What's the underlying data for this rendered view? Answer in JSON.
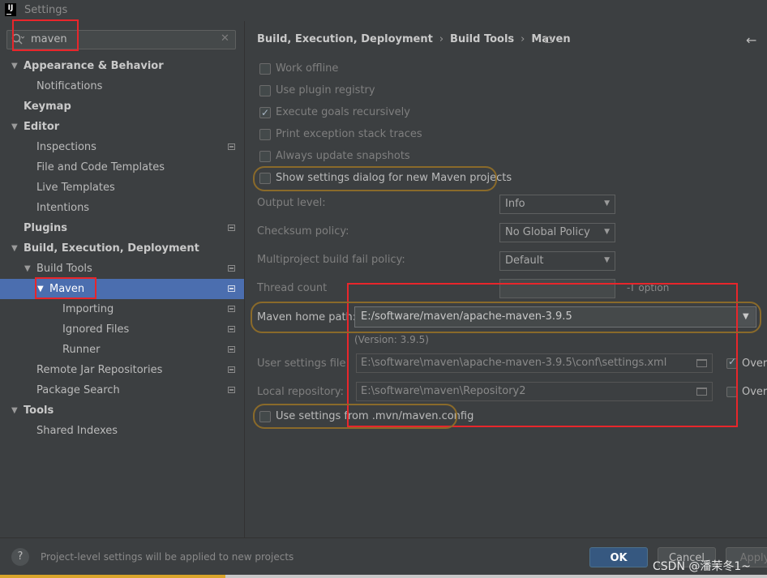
{
  "window": {
    "title": "Settings",
    "app_icon": "IJ"
  },
  "search": {
    "value": "maven"
  },
  "sidebar": {
    "items": [
      {
        "label": "Appearance & Behavior",
        "bold": true,
        "arrow": "▾"
      },
      {
        "label": "Notifications"
      },
      {
        "label": "Keymap",
        "bold": true
      },
      {
        "label": "Editor",
        "bold": true,
        "arrow": "▾"
      },
      {
        "label": "Inspections"
      },
      {
        "label": "File and Code Templates"
      },
      {
        "label": "Live Templates"
      },
      {
        "label": "Intentions"
      },
      {
        "label": "Plugins",
        "bold": true
      },
      {
        "label": "Build, Execution, Deployment",
        "bold": true,
        "arrow": "▾"
      },
      {
        "label": "Build Tools",
        "arrow": "▾"
      },
      {
        "label": "Maven",
        "arrow": "▾",
        "selected": true
      },
      {
        "label": "Importing"
      },
      {
        "label": "Ignored Files"
      },
      {
        "label": "Runner"
      },
      {
        "label": "Remote Jar Repositories"
      },
      {
        "label": "Package Search"
      },
      {
        "label": "Tools",
        "bold": true,
        "arrow": "▾"
      },
      {
        "label": "Shared Indexes"
      }
    ]
  },
  "breadcrumb": {
    "part1": "Build, Execution, Deployment",
    "part2": "Build Tools",
    "part3": "Maven",
    "separator": "›"
  },
  "options": {
    "work_offline": "Work offline",
    "use_plugin_registry": "Use plugin registry",
    "execute_goals_recursively": "Execute goals recursively",
    "print_exception": "Print exception stack traces",
    "always_update": "Always update snapshots",
    "show_settings_dialog": "Show settings dialog for new Maven projects"
  },
  "fields": {
    "output_level_label": "Output level:",
    "output_level_value": "Info",
    "checksum_label": "Checksum policy:",
    "checksum_value": "No Global Policy",
    "multiproject_label": "Multiproject build fail policy:",
    "multiproject_value": "Default",
    "thread_count_label": "Thread count",
    "thread_count_hint": "-T option",
    "maven_home_label": "Maven home path:",
    "maven_home_value": "E:/software/maven/apache-maven-3.9.5",
    "version": "(Version: 3.9.5)",
    "user_settings_label": "User settings file:",
    "user_settings_value": "E:\\software\\maven\\apache-maven-3.9.5\\conf\\settings.xml",
    "override1": "Overr",
    "local_repo_label": "Local repository:",
    "local_repo_value": "E:\\software\\maven\\Repository2",
    "override2": "Overr",
    "use_mvn_config": "Use settings from .mvn/maven.config"
  },
  "footer": {
    "help": "?",
    "status": "Project-level settings will be applied to new projects",
    "ok": "OK",
    "cancel": "Cancel",
    "apply": "Apply"
  },
  "watermark": "CSDN @潘茉冬1~",
  "colors": {
    "selection": "#4b6eaf",
    "highlight_red": "#e8262b",
    "ok_button": "#365880"
  }
}
